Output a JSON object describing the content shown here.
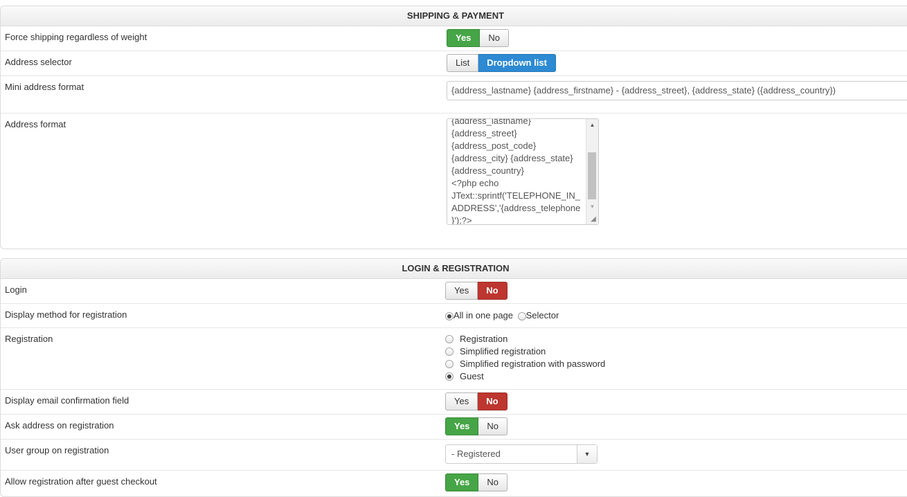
{
  "shipping": {
    "header": "SHIPPING & PAYMENT",
    "rows": {
      "force_shipping": {
        "label": "Force shipping regardless of weight",
        "yes": "Yes",
        "no": "No",
        "selected": "Yes"
      },
      "address_selector": {
        "label": "Address selector",
        "option1": "List",
        "option2": "Dropdown list",
        "selected": "Dropdown list"
      },
      "mini_address": {
        "label": "Mini address format",
        "value": "{address_lastname} {address_firstname} - {address_street}, {address_state} ({address_country})"
      },
      "address_format": {
        "label": "Address format",
        "lines": [
          "{address_lastname}",
          "{address_street}",
          "{address_post_code}",
          "{address_city} {address_state}",
          "{address_country}",
          "<?php echo",
          "JText::sprintf('TELEPHONE_IN_",
          "ADDRESS','{address_telephone",
          "}');?>"
        ]
      }
    }
  },
  "login": {
    "header": "LOGIN & REGISTRATION",
    "rows": {
      "login": {
        "label": "Login",
        "yes": "Yes",
        "no": "No",
        "selected": "No"
      },
      "display_method": {
        "label": "Display method for registration",
        "option1": "All in one page",
        "option2": "Selector",
        "selected": "All in one page"
      },
      "registration": {
        "label": "Registration",
        "options": [
          "Registration",
          "Simplified registration",
          "Simplified registration with password",
          "Guest"
        ],
        "selected": "Guest"
      },
      "email_confirm": {
        "label": "Display email confirmation field",
        "yes": "Yes",
        "no": "No",
        "selected": "No"
      },
      "ask_address": {
        "label": "Ask address on registration",
        "yes": "Yes",
        "no": "No",
        "selected": "Yes"
      },
      "user_group": {
        "label": "User group on registration",
        "value": "- Registered"
      },
      "allow_after_guest": {
        "label": "Allow registration after guest checkout",
        "yes": "Yes",
        "no": "No",
        "selected": "Yes"
      }
    }
  },
  "colors": {
    "yes_active": "#46a546",
    "no_active": "#bd362f",
    "selected_option": "#2d8ad3"
  },
  "icons": {
    "select_arrow": "caret-down-icon",
    "scroll_up": "triangle-up-icon",
    "scroll_down": "triangle-down-icon",
    "resize": "resize-grip-icon"
  }
}
